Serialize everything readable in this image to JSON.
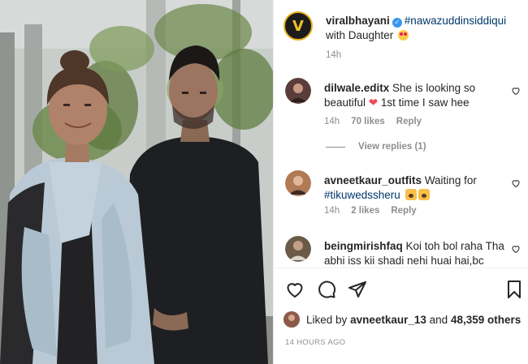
{
  "post": {
    "author": "viralbhayani",
    "caption_hashtag": "#nawazuddinsiddiqui",
    "caption_text": "with Daughter",
    "caption_time": "14h",
    "avatar_letter": "V"
  },
  "comments": [
    {
      "username": "dilwale.editx",
      "text_before": "She is looking so beautiful",
      "text_after": "1st time I saw hee",
      "time": "14h",
      "likes": "70 likes",
      "reply": "Reply",
      "avatar_color": "#5a3d3a"
    },
    {
      "username": "avneetkaur_outfits",
      "text": "Waiting for",
      "hashtag": "#tikuwedssheru",
      "time": "14h",
      "likes": "2 likes",
      "reply": "Reply",
      "avatar_color": "#b07a55"
    },
    {
      "username": "beingmirishfaq",
      "text": "Koi toh bol raha Tha abhi iss kii shadi nehi huai hai,bc",
      "avatar_color": "#6b5a48"
    }
  ],
  "view_replies": "View replies (1)",
  "liked_by": {
    "prefix": "Liked by",
    "user": "avneetkaur_13",
    "middle": "and",
    "count": "48,359 others"
  },
  "post_time": "14 HOURS AGO"
}
